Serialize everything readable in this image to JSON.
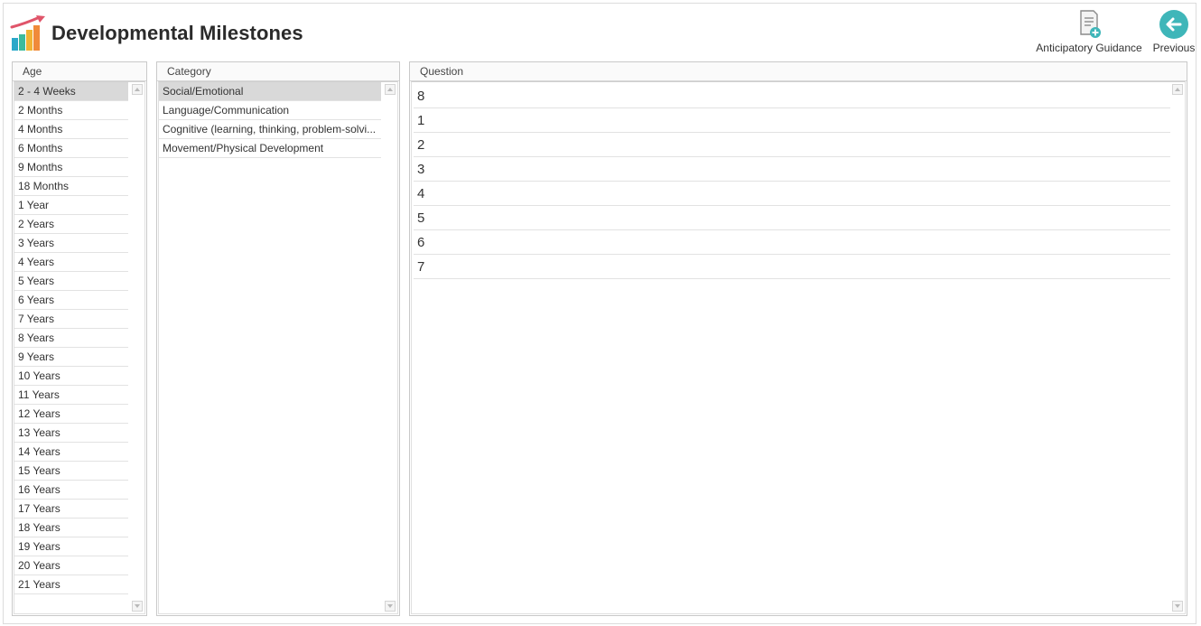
{
  "header": {
    "title": "Developmental Milestones",
    "logo_icon": "bar-chart-growth-icon"
  },
  "toolbar": {
    "guidance_label": "Anticipatory Guidance",
    "guidance_icon": "document-add-icon",
    "previous_label": "Previous",
    "previous_icon": "back-arrow-icon"
  },
  "age_panel": {
    "header": "Age",
    "selected_index": 0,
    "items": [
      "2 - 4 Weeks",
      "2 Months",
      "4 Months",
      "6 Months",
      "9 Months",
      "18 Months",
      "1 Year",
      "2 Years",
      "3 Years",
      "4 Years",
      "5 Years",
      "6 Years",
      "7 Years",
      "8 Years",
      "9 Years",
      "10 Years",
      "11 Years",
      "12 Years",
      "13 Years",
      "14 Years",
      "15 Years",
      "16 Years",
      "17 Years",
      "18 Years",
      "19 Years",
      "20 Years",
      "21 Years"
    ]
  },
  "category_panel": {
    "header": "Category",
    "selected_index": 0,
    "items": [
      "Social/Emotional",
      "Language/Communication",
      "Cognitive (learning, thinking, problem-solvi...",
      "Movement/Physical Development"
    ]
  },
  "question_panel": {
    "header": "Question",
    "items": [
      "8",
      "1",
      "2",
      "3",
      "4",
      "5",
      "6",
      "7"
    ]
  },
  "colors": {
    "accent_teal": "#3fb6b9",
    "selected_row": "#d9d9d9"
  }
}
